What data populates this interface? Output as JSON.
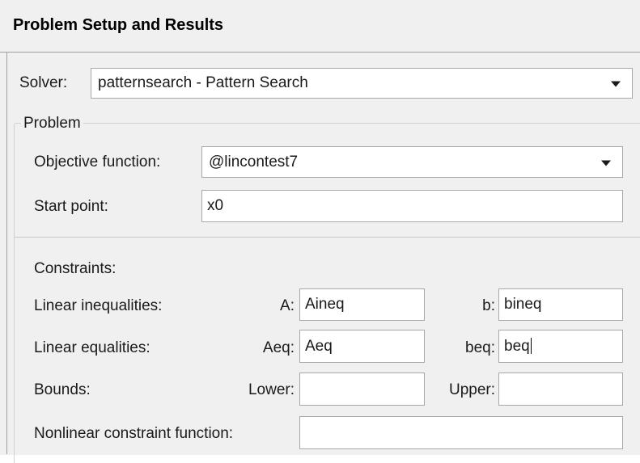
{
  "header": {
    "title": "Problem Setup and Results"
  },
  "solver": {
    "label": "Solver:",
    "value": "patternsearch - Pattern Search"
  },
  "problem": {
    "group_label": "Problem",
    "objective_label": "Objective function:",
    "objective_value": "@lincontest7",
    "start_label": "Start point:",
    "start_value": "x0"
  },
  "constraints": {
    "heading": "Constraints:",
    "linear_inequalities": {
      "label": "Linear inequalities:",
      "a_label": "A:",
      "a_value": "Aineq",
      "b_label": "b:",
      "b_value": "bineq"
    },
    "linear_equalities": {
      "label": "Linear equalities:",
      "aeq_label": "Aeq:",
      "aeq_value": "Aeq",
      "beq_label": "beq:",
      "beq_value": "beq"
    },
    "bounds": {
      "label": "Bounds:",
      "lower_label": "Lower:",
      "lower_value": "",
      "upper_label": "Upper:",
      "upper_value": ""
    },
    "nonlinear": {
      "label": "Nonlinear constraint function:",
      "value": ""
    }
  }
}
